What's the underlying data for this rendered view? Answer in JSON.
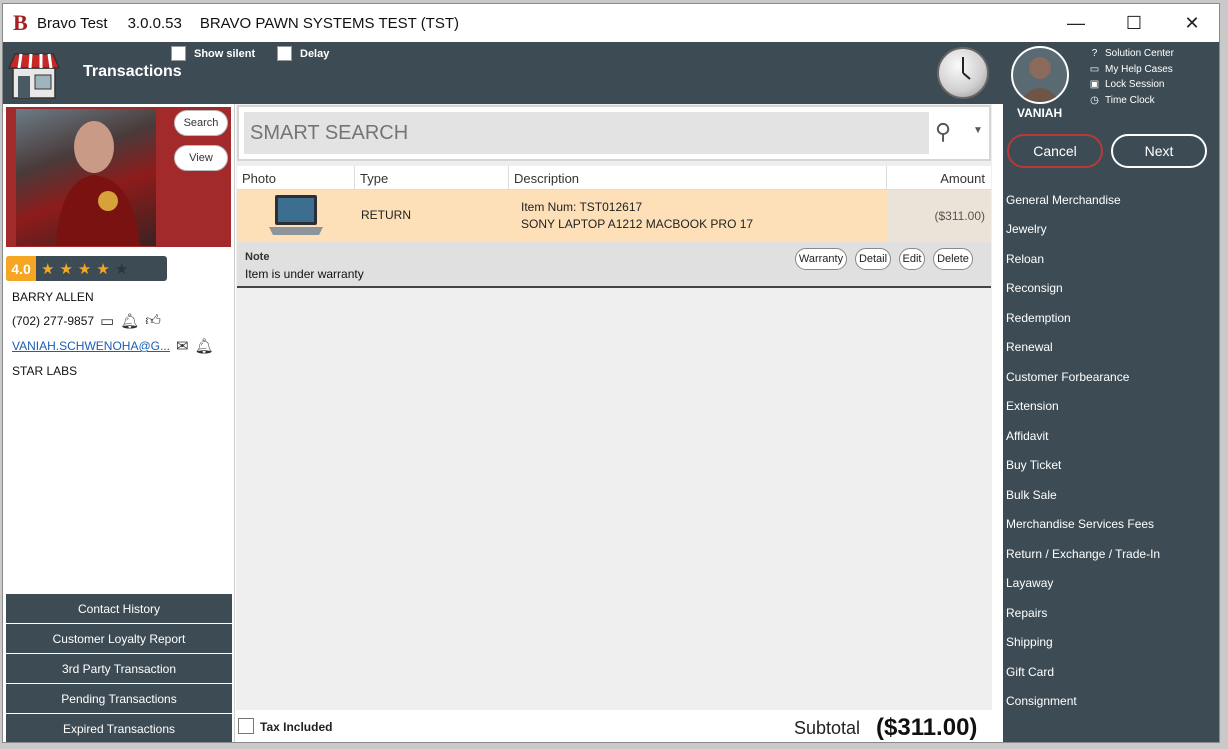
{
  "titlebar": {
    "app_name": "Bravo Test",
    "version": "3.0.0.53",
    "system_name": "BRAVO PAWN SYSTEMS TEST (TST)",
    "minimize": "—",
    "maximize": "☐",
    "close": "✕"
  },
  "header": {
    "title": "Transactions",
    "show_silent_label": "Show silent",
    "delay_label": "Delay"
  },
  "user": {
    "name": "VANIAH",
    "help_links": [
      {
        "label": "Solution Center",
        "icon": "question-circle-icon"
      },
      {
        "label": "My Help Cases",
        "icon": "folder-icon"
      },
      {
        "label": "Lock Session",
        "icon": "lock-icon"
      },
      {
        "label": "Time Clock",
        "icon": "clock-icon"
      }
    ]
  },
  "actions": {
    "cancel": "Cancel",
    "next": "Next"
  },
  "menu": [
    "General Merchandise",
    "Jewelry",
    "Reloan",
    "Reconsign",
    "Redemption",
    "Renewal",
    "Customer Forbearance",
    "Extension",
    "Affidavit",
    "Buy Ticket",
    "Bulk Sale",
    "Merchandise Services Fees",
    "Return / Exchange / Trade-In",
    "Layaway",
    "Repairs",
    "Shipping",
    "Gift Card",
    "Consignment"
  ],
  "customer": {
    "search_label": "Search",
    "view_label": "View",
    "rating": "4.0",
    "stars_filled": 4,
    "stars_total": 5,
    "name": "BARRY ALLEN",
    "phone": "(702) 277-9857",
    "email": "VANIAH.SCHWENOHA@G...",
    "company": "STAR LABS"
  },
  "left_buttons": [
    "Contact History",
    "Customer Loyalty Report",
    "3rd Party Transaction",
    "Pending Transactions",
    "Expired Transactions"
  ],
  "search": {
    "placeholder": "SMART SEARCH"
  },
  "table": {
    "columns": {
      "photo": "Photo",
      "type": "Type",
      "description": "Description",
      "amount": "Amount"
    },
    "rows": [
      {
        "type": "RETURN",
        "item_num": "Item Num: TST012617",
        "description": "SONY LAPTOP A1212 MACBOOK PRO 17",
        "amount": "($311.00)"
      }
    ]
  },
  "note": {
    "label": "Note",
    "text": "Item is under warranty",
    "buttons": {
      "warranty": "Warranty",
      "detail": "Detail",
      "edit": "Edit",
      "delete": "Delete"
    }
  },
  "footer": {
    "tax_included": "Tax Included",
    "subtotal_label": "Subtotal",
    "subtotal_value": "($311.00)"
  },
  "colors": {
    "panel": "#3d4c54",
    "accent_red": "#a32a2a",
    "row_highlight": "#fde0b8",
    "star": "#f5a623"
  }
}
